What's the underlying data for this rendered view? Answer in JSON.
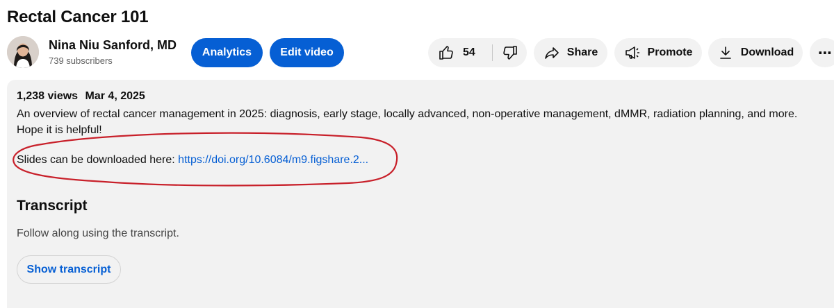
{
  "video": {
    "title": "Rectal Cancer 101"
  },
  "channel": {
    "name": "Nina Niu Sanford, MD",
    "subscribers": "739 subscribers"
  },
  "actions": {
    "analytics": "Analytics",
    "edit_video": "Edit video",
    "like_count": "54",
    "share": "Share",
    "promote": "Promote",
    "download": "Download",
    "more": "⋯"
  },
  "description": {
    "views": "1,238 views",
    "date": "Mar 4, 2025",
    "text": "An overview of rectal cancer management in 2025: diagnosis, early stage, locally advanced, non-operative management, dMMR, radiation planning, and more. Hope it is helpful!",
    "slides_prefix": "Slides can be downloaded here: ",
    "slides_link": "https://doi.org/10.6084/m9.figshare.2...",
    "annotation_color": "#c8202a"
  },
  "transcript": {
    "heading": "Transcript",
    "subtitle": "Follow along using the transcript.",
    "button": "Show transcript"
  },
  "colors": {
    "accent": "#065fd4",
    "button_bg": "#f2f2f2"
  }
}
